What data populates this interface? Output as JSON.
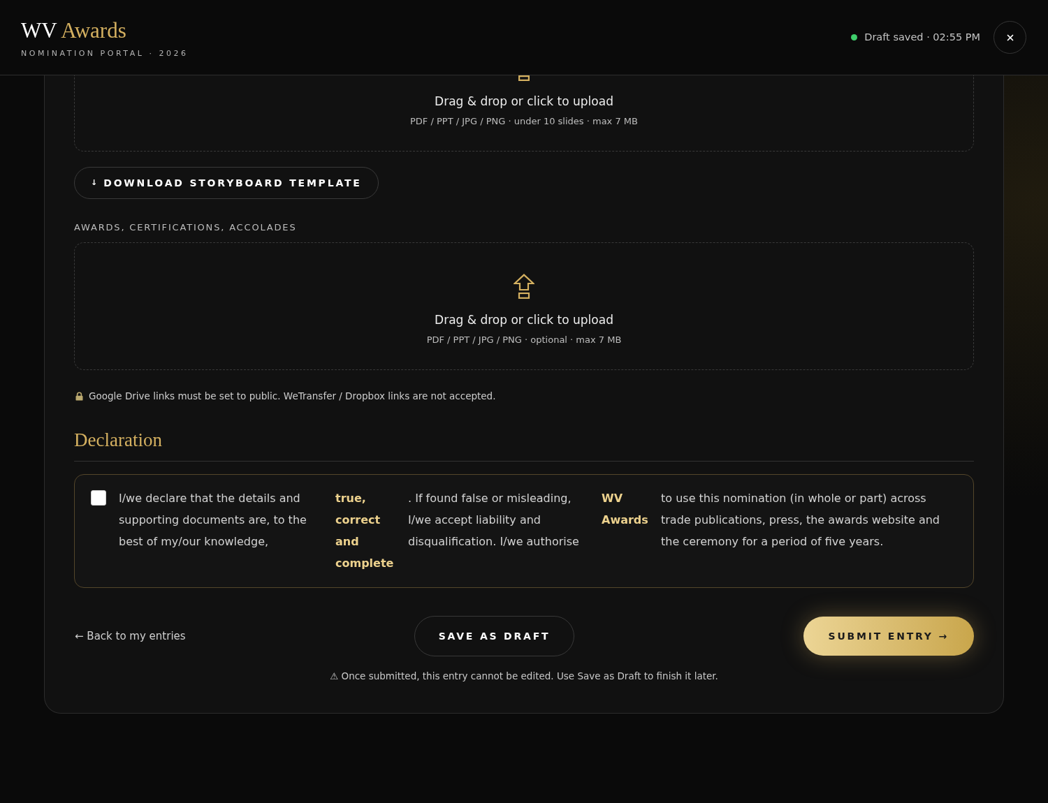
{
  "header": {
    "logo": {
      "mark": "WV",
      "accent": "Awards"
    },
    "tagline": "NOMINATION PORTAL · 2026",
    "save_status": "Draft saved · 02:55 PM"
  },
  "upload_zones": [
    {
      "title": "Drag & drop or click to upload",
      "hint": "PDF / PPT / JPG / PNG · under 10 slides · max 7 MB"
    },
    {
      "label": "AWARDS, CERTIFICATIONS, ACCOLADES",
      "title": "Drag & drop or click to upload",
      "hint": "PDF / PPT / JPG / PNG · optional · max 7 MB"
    }
  ],
  "template_button": {
    "glyph": "↓",
    "label": "DOWNLOAD STORYBOARD TEMPLATE"
  },
  "links_note": "Google Drive links must be set to public. WeTransfer / Dropbox links are not accepted.",
  "declaration": {
    "heading": "Declaration",
    "checked": false,
    "segments": [
      {
        "kind": "plain",
        "text": "I/we declare that the details and supporting documents are, to the best of my/our knowledge,"
      },
      {
        "kind": "strong",
        "text": "true, correct and complete"
      },
      {
        "kind": "plain",
        "text": ". If found false or misleading, I/we accept liability and disqualification. I/we authorise"
      },
      {
        "kind": "strong",
        "text": "WV Awards"
      },
      {
        "kind": "plain",
        "text": "to use this nomination (in whole or part) across trade publications, press, the awards website and the ceremony for a period of five years."
      }
    ]
  },
  "actions": {
    "back_link": "← Back to my entries",
    "save_draft": "SAVE AS DRAFT",
    "submit": "SUBMIT ENTRY →",
    "note": "⚠ Once submitted, this entry cannot be edited. Use Save as Draft to finish it later."
  }
}
